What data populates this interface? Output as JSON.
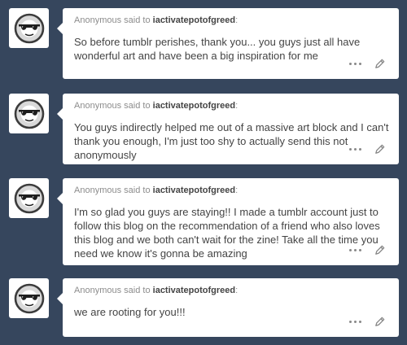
{
  "asks": [
    {
      "sender": "Anonymous",
      "said_to": "said to",
      "blog": "iactivatepotofgreed",
      "colon": ":",
      "question": "So before tumblr perishes, thank you... you guys just all have wonderful art and have been a big inspiration for me"
    },
    {
      "sender": "Anonymous",
      "said_to": "said to",
      "blog": "iactivatepotofgreed",
      "colon": ":",
      "question": "You guys indirectly helped me out of a massive art block and I can't thank you enough, I'm just too shy to actually send this not anonymously"
    },
    {
      "sender": "Anonymous",
      "said_to": "said to",
      "blog": "iactivatepotofgreed",
      "colon": ":",
      "question": "I'm so glad you guys are staying!! I made a tumblr account just to follow this blog on the recommendation of a friend who also loves this blog and we both can't wait for the zine! Take all the time you need we know it's gonna be amazing"
    },
    {
      "sender": "Anonymous",
      "said_to": "said to",
      "blog": "iactivatepotofgreed",
      "colon": ":",
      "question": "we are rooting for you!!!"
    }
  ],
  "icons": {
    "avatar": "anonymous-sunglasses-icon",
    "more": "ellipsis-icon",
    "answer": "pencil-icon"
  },
  "colors": {
    "background": "#36465d",
    "card": "#ffffff",
    "text": "#444444",
    "muted": "#8c8c8c"
  }
}
